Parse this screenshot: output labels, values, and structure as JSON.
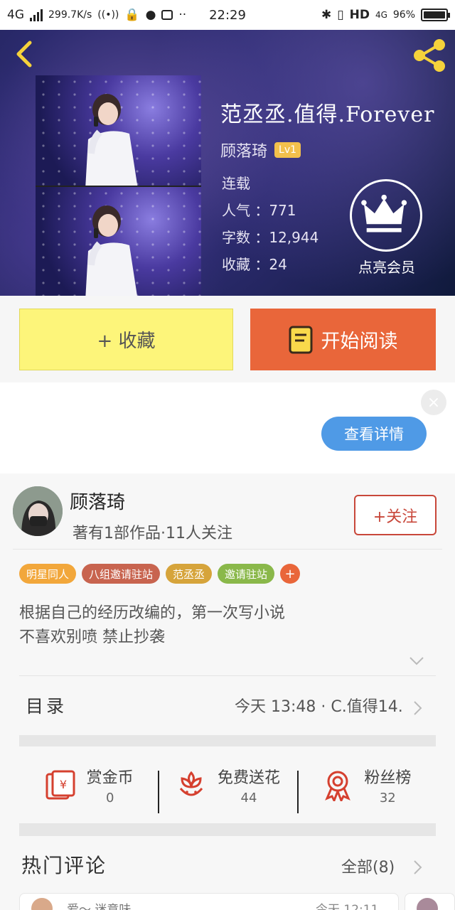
{
  "status_bar": {
    "network": "4G",
    "speed": "299.7K/s",
    "time": "22:29",
    "hd": "HD",
    "net_type": "4G",
    "battery": "96%"
  },
  "book": {
    "title": "范丞丞.值得.Forever",
    "author": "顾落琦",
    "author_level": "Lv1",
    "status": "连载",
    "popularity_label": "人气",
    "popularity": "771",
    "words_label": "字数",
    "words": "12,944",
    "favorites_label": "收藏",
    "favorites": "24",
    "vip_label": "点亮会员"
  },
  "actions": {
    "favorite_label": "+ 收藏",
    "read_label": "开始阅读"
  },
  "ad": {
    "close": "×",
    "detail_label": "查看详情"
  },
  "author_card": {
    "name": "顾落琦",
    "stats": "著有1部作品·11人关注",
    "follow_label": "+关注"
  },
  "tags": [
    {
      "label": "明星同人",
      "color": "#f2a73b"
    },
    {
      "label": "八组邀请驻站",
      "color": "#c8644f"
    },
    {
      "label": "范丞丞",
      "color": "#d6a43b"
    },
    {
      "label": "邀请驻站",
      "color": "#8ab84a"
    }
  ],
  "tag_add": "+",
  "description": {
    "line1": "根据自己的经历改编的，第一次写小说",
    "line2": "不喜欢别喷 禁止抄袭"
  },
  "toc": {
    "label": "目录",
    "latest": "今天 13:48 · C.值得14."
  },
  "stats": [
    {
      "icon": "red-envelope-icon",
      "label": "赏金币",
      "value": "0"
    },
    {
      "icon": "flower-icon",
      "label": "免费送花",
      "value": "44"
    },
    {
      "icon": "medal-icon",
      "label": "粉丝榜",
      "value": "32"
    }
  ],
  "comments": {
    "title": "热门评论",
    "all_label": "全部(8)",
    "first_name": "爱～ 迷意味",
    "first_time": "今天 12:11"
  },
  "colors": {
    "accent_red": "#c8473a",
    "read_orange": "#e9663a",
    "fav_yellow": "#fdf57a",
    "detail_blue": "#4f9ae6"
  }
}
